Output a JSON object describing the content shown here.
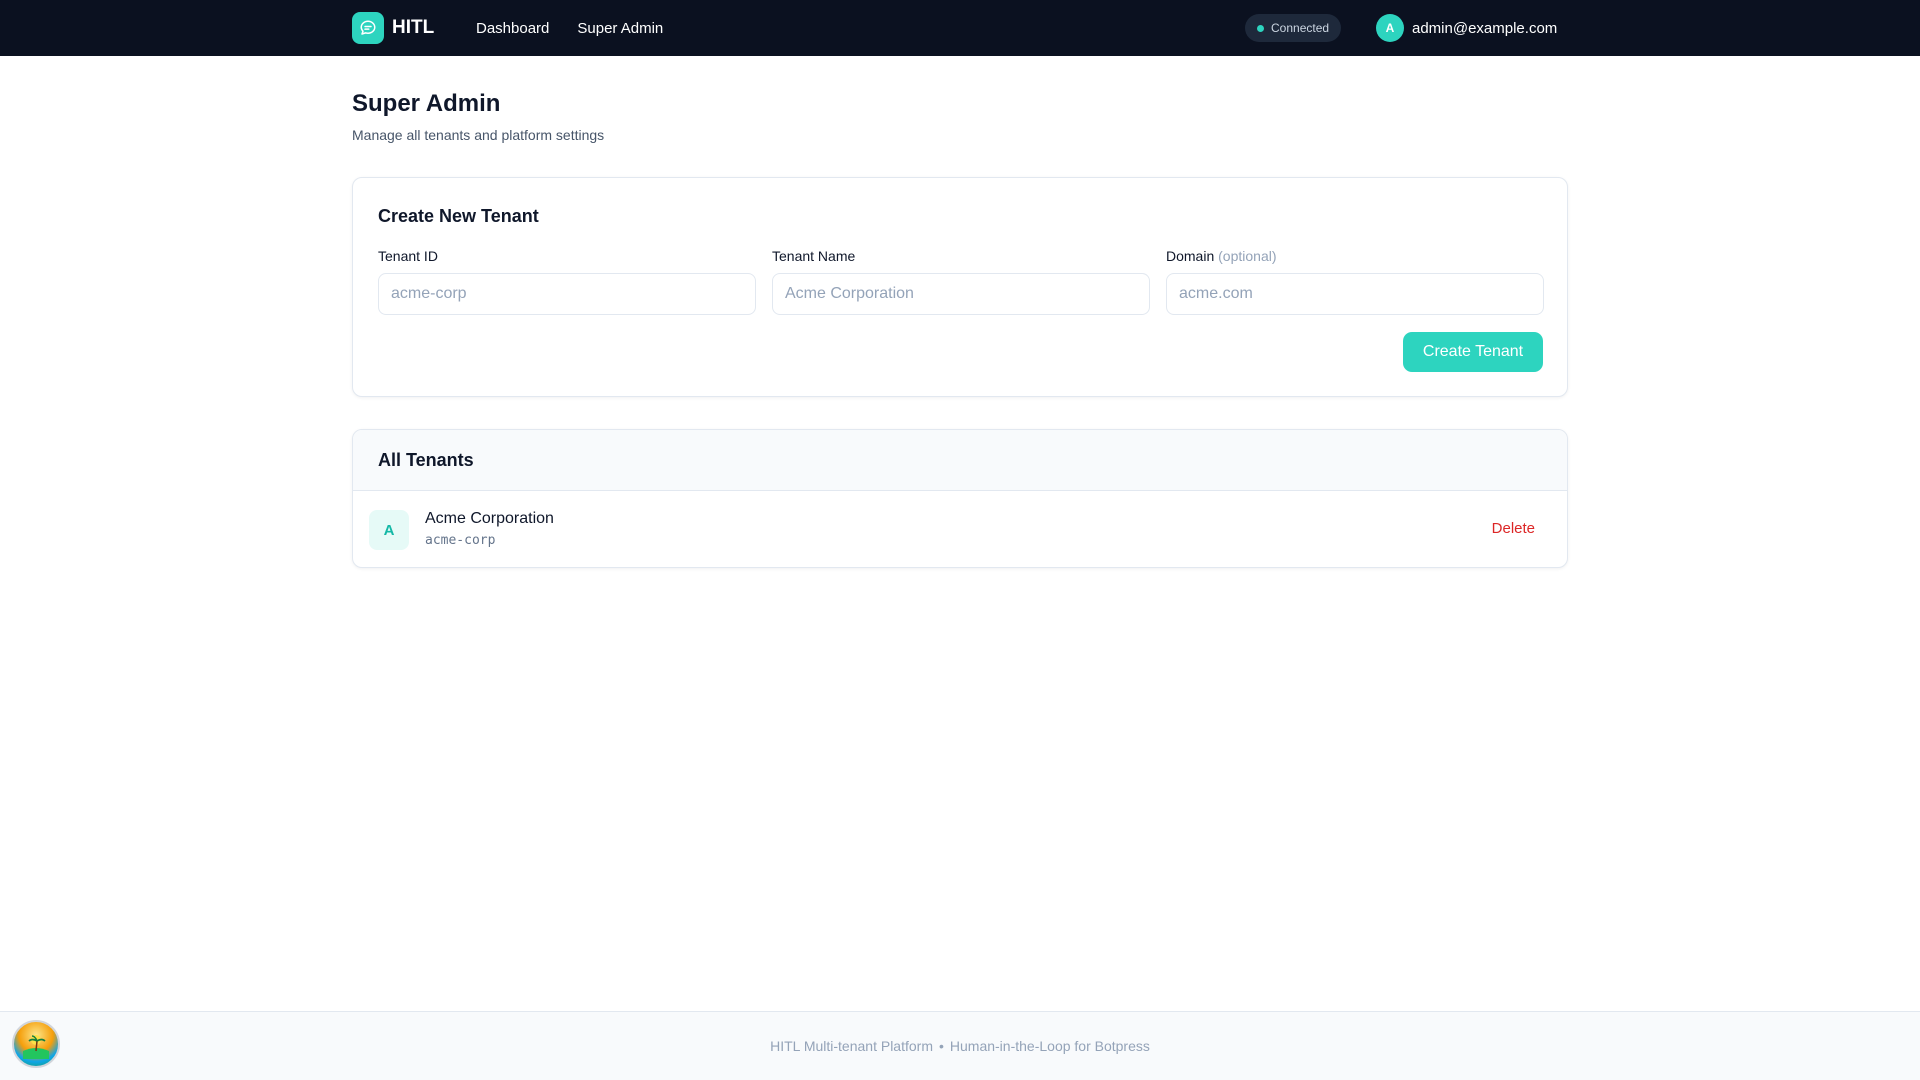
{
  "header": {
    "brand": "HITL",
    "nav": [
      "Dashboard",
      "Super Admin"
    ],
    "status": "Connected",
    "user_initial": "A",
    "user_email": "admin@example.com"
  },
  "page": {
    "title": "Super Admin",
    "subtitle": "Manage all tenants and platform settings"
  },
  "create_tenant": {
    "title": "Create New Tenant",
    "fields": [
      {
        "label": "Tenant ID",
        "placeholder": "acme-corp",
        "value": ""
      },
      {
        "label": "Tenant Name",
        "placeholder": "Acme Corporation",
        "value": ""
      },
      {
        "label": "Domain",
        "label_suffix": "(optional)",
        "placeholder": "acme.com",
        "value": ""
      }
    ],
    "submit_label": "Create Tenant"
  },
  "tenants": {
    "title": "All Tenants",
    "items": [
      {
        "initial": "A",
        "name": "Acme Corporation",
        "id": "acme-corp",
        "action": "Delete"
      }
    ]
  },
  "footer": {
    "left": "HITL Multi-tenant Platform",
    "separator": "•",
    "right": "Human-in-the-Loop for Botpress"
  },
  "colors": {
    "accent": "#2dd4bf",
    "topbar": "#0b1120",
    "danger": "#dc2626"
  },
  "icons": {
    "brand": "chat-bubble-icon",
    "corner_badge": "beach-icon"
  }
}
